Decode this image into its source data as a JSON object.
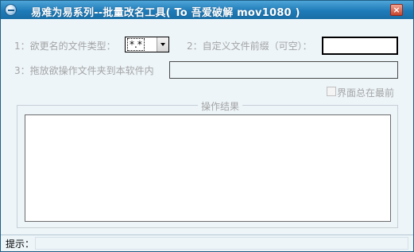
{
  "window": {
    "title": "易难为易系列--批量改名工具( To 吾爱破解 mov1080 )",
    "close_label": "×"
  },
  "form": {
    "file_type_label": "1：欲更名的文件类型：",
    "file_type_value": "*.*",
    "prefix_label": "2：自定义文件前缀（可空）：",
    "prefix_value": "",
    "drop_label": "3：拖放欲操作文件夹到本软件内",
    "drop_value": "",
    "topmost_label": "界面总在最前"
  },
  "results": {
    "group_title": "操作结果",
    "content": ""
  },
  "status": {
    "label": "提示：",
    "value": ""
  },
  "colors": {
    "title_bar": "#1f7bb8",
    "window_bg": "#edf5f9",
    "disabled_text": "#a4a4a4"
  }
}
